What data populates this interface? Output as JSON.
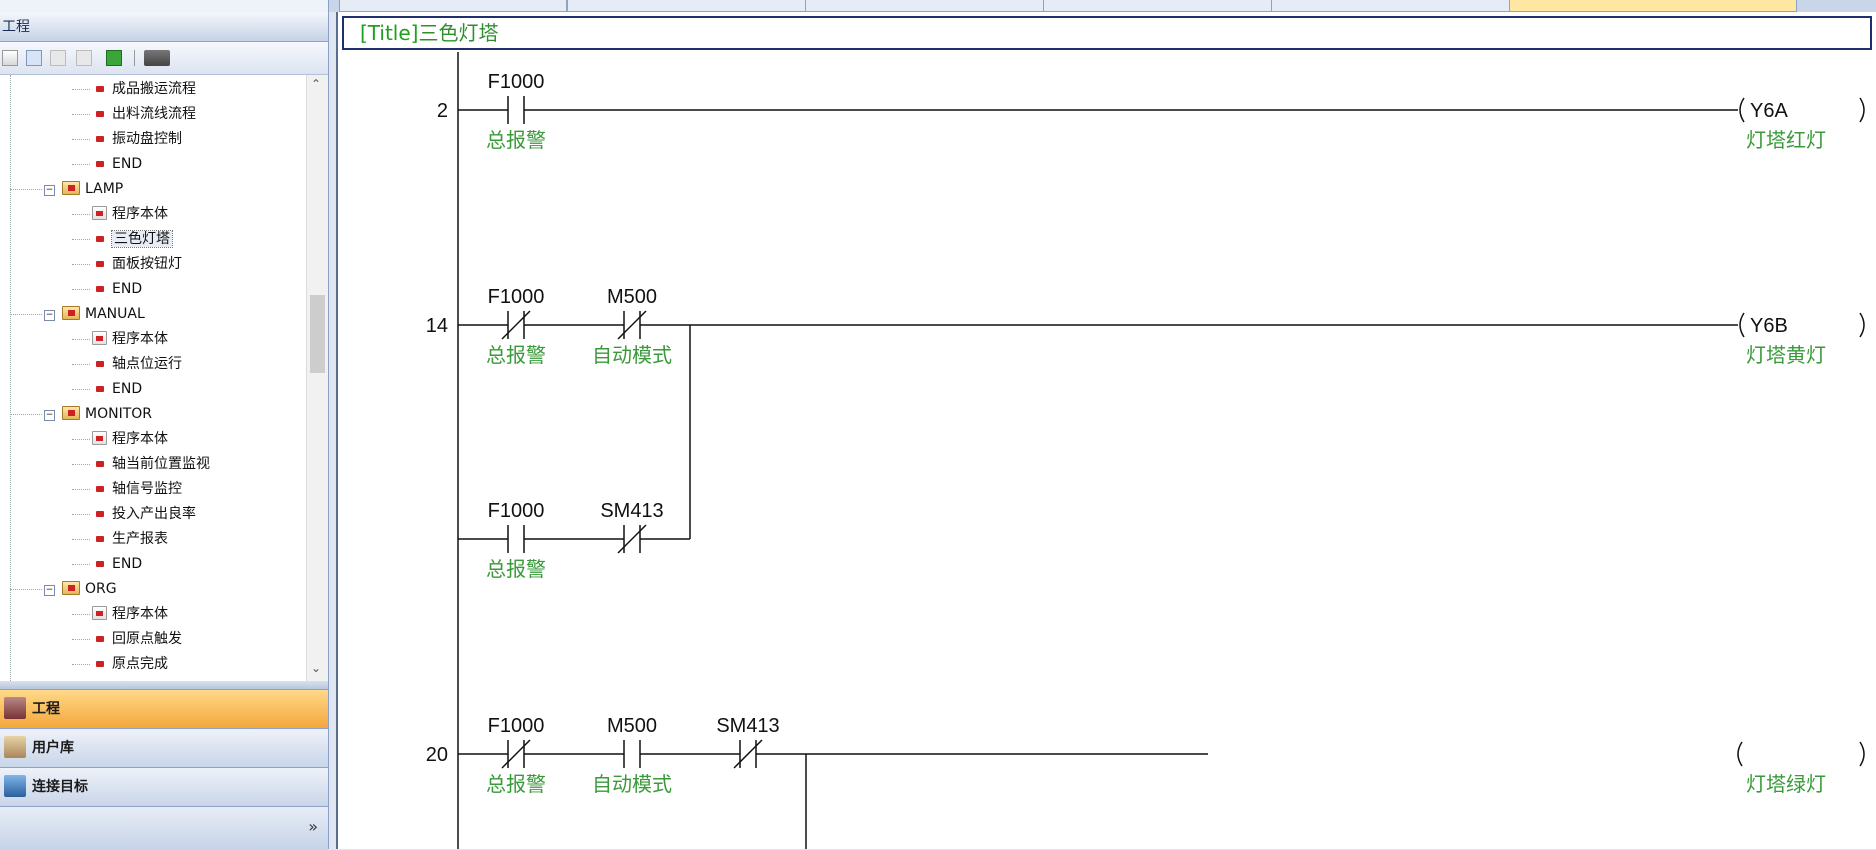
{
  "left_panel": {
    "title": "工程",
    "tree": [
      {
        "label": "成品搬运流程",
        "kind": "small"
      },
      {
        "label": "出料流线流程",
        "kind": "small"
      },
      {
        "label": "振动盘控制",
        "kind": "small"
      },
      {
        "label": "END",
        "kind": "small"
      },
      {
        "label": "LAMP",
        "kind": "folder"
      },
      {
        "label": "程序本体",
        "kind": "doc"
      },
      {
        "label": "三色灯塔",
        "kind": "small",
        "selected": true
      },
      {
        "label": "面板按钮灯",
        "kind": "small"
      },
      {
        "label": "END",
        "kind": "small"
      },
      {
        "label": "MANUAL",
        "kind": "folder"
      },
      {
        "label": "程序本体",
        "kind": "doc"
      },
      {
        "label": "轴点位运行",
        "kind": "small"
      },
      {
        "label": "END",
        "kind": "small"
      },
      {
        "label": "MONITOR",
        "kind": "folder"
      },
      {
        "label": "程序本体",
        "kind": "doc"
      },
      {
        "label": "轴当前位置监视",
        "kind": "small"
      },
      {
        "label": "轴信号监控",
        "kind": "small"
      },
      {
        "label": "投入产出良率",
        "kind": "small"
      },
      {
        "label": "生产报表",
        "kind": "small"
      },
      {
        "label": "END",
        "kind": "small"
      },
      {
        "label": "ORG",
        "kind": "folder"
      },
      {
        "label": "程序本体",
        "kind": "doc"
      },
      {
        "label": "回原点触发",
        "kind": "small"
      },
      {
        "label": "原点完成",
        "kind": "small"
      }
    ],
    "nav_buttons": {
      "project": "工程",
      "user_library": "用户库",
      "connection": "连接目标"
    },
    "more_glyph": "»"
  },
  "editor": {
    "title_tag": "[Title]",
    "title_text": "三色灯塔",
    "rungs": [
      {
        "step": "2",
        "contacts": [
          {
            "device": "F1000",
            "comment": "总报警",
            "type": "NO"
          }
        ],
        "coil": {
          "device": "Y6A",
          "comment": "灯塔红灯"
        }
      },
      {
        "step": "14",
        "contacts": [
          {
            "device": "F1000",
            "comment": "总报警",
            "type": "NC"
          },
          {
            "device": "M500",
            "comment": "自动模式",
            "type": "NC"
          }
        ],
        "branch": [
          {
            "device": "F1000",
            "comment": "总报警",
            "type": "NO"
          },
          {
            "device": "SM413",
            "comment": "",
            "type": "NC"
          }
        ],
        "coil": {
          "device": "Y6B",
          "comment": "灯塔黄灯"
        }
      },
      {
        "step": "20",
        "contacts": [
          {
            "device": "F1000",
            "comment": "总报警",
            "type": "NC"
          },
          {
            "device": "M500",
            "comment": "自动模式",
            "type": "NO"
          },
          {
            "device": "SM413",
            "comment": "",
            "type": "NC"
          }
        ],
        "coil": {
          "device": "",
          "comment": "灯塔绿灯"
        }
      }
    ]
  }
}
